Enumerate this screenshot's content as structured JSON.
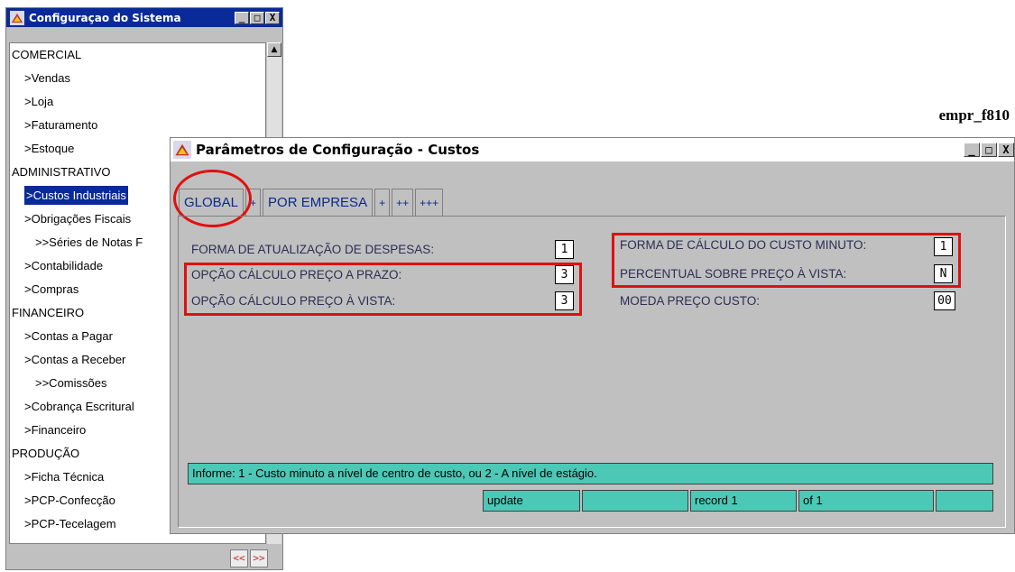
{
  "sys_window": {
    "title": "Configuraçao do Sistema",
    "buttons": [
      "_",
      "□",
      "X"
    ],
    "menu_items": [
      {
        "label": "COMERCIAL",
        "level": 0
      },
      {
        "label": ">Vendas",
        "level": 1
      },
      {
        "label": ">Loja",
        "level": 1
      },
      {
        "label": ">Faturamento",
        "level": 1
      },
      {
        "label": ">Estoque",
        "level": 1
      },
      {
        "label": "ADMINISTRATIVO",
        "level": 0
      },
      {
        "label": ">Custos Industriais",
        "level": 1,
        "selected": true
      },
      {
        "label": ">Obrigações Fiscais",
        "level": 1
      },
      {
        "label": ">>Séries de Notas F",
        "level": 2
      },
      {
        "label": ">Contabilidade",
        "level": 1
      },
      {
        "label": ">Compras",
        "level": 1
      },
      {
        "label": "FINANCEIRO",
        "level": 0
      },
      {
        "label": ">Contas a Pagar",
        "level": 1
      },
      {
        "label": ">Contas a Receber",
        "level": 1
      },
      {
        "label": ">>Comissões",
        "level": 2
      },
      {
        "label": ">Cobrança Escritural",
        "level": 1
      },
      {
        "label": ">Financeiro",
        "level": 1
      },
      {
        "label": "PRODUÇÃO",
        "level": 0
      },
      {
        "label": ">Ficha Técnica",
        "level": 1
      },
      {
        "label": ">PCP-Confecção",
        "level": 1
      },
      {
        "label": ">PCP-Tecelagem",
        "level": 1
      }
    ],
    "nav": {
      "prev": "<<",
      "next": ">>"
    }
  },
  "program_id": "empr_f810",
  "config_window": {
    "title": "Parâmetros de Configuração - Custos",
    "buttons": [
      "_",
      "□",
      "X"
    ],
    "tabs": [
      {
        "label": "GLOBAL",
        "active": true
      },
      {
        "label": "+"
      },
      {
        "label": "POR EMPRESA"
      },
      {
        "label": "+"
      },
      {
        "label": "++"
      },
      {
        "label": "+++"
      }
    ],
    "left_fields": [
      {
        "label": "FORMA DE ATUALIZAÇÃO DE DESPESAS:",
        "value": "1"
      },
      {
        "label": "OPÇÃO CÁLCULO PREÇO A PRAZO:",
        "value": "3"
      },
      {
        "label": "OPÇÃO CÁLCULO PREÇO À VISTA:",
        "value": "3"
      }
    ],
    "right_fields": [
      {
        "label": "FORMA DE CÁLCULO DO CUSTO MINUTO:",
        "value": "1"
      },
      {
        "label": "PERCENTUAL SOBRE PREÇO À VISTA:",
        "value": "N"
      },
      {
        "label": "MOEDA PREÇO CUSTO:",
        "value": "00"
      }
    ],
    "info": "Informe:  1 - Custo minuto a nível de centro de custo, ou 2 - A nível de estágio.",
    "status_cells": [
      "update",
      "",
      "record  1",
      "of   1",
      ""
    ]
  },
  "colors": {
    "title_active": "#0a2a9a",
    "status_bar": "#4cc8b6",
    "highlight": "#e01010"
  }
}
